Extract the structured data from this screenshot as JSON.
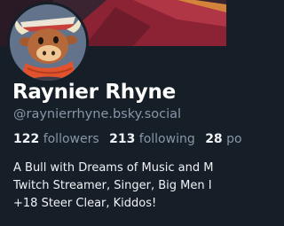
{
  "profile": {
    "display_name": "Raynier Rhyne",
    "handle": "@raynierrhyne.bsky.social",
    "stats": {
      "followers_count": "122",
      "followers_label": "followers",
      "following_count": "213",
      "following_label": "following",
      "posts_count": "28",
      "posts_label": "po"
    },
    "bio_lines": [
      "A Bull with Dreams of Music and M",
      "Twitch Streamer, Singer, Big Men I",
      "+18 Steer Clear, Kiddos!"
    ]
  },
  "colors": {
    "background": "#161e27",
    "text_primary": "#ffffff",
    "text_secondary": "#8796a8"
  },
  "icons": {
    "avatar": "bull-character-avatar",
    "banner": "banner-artwork"
  }
}
